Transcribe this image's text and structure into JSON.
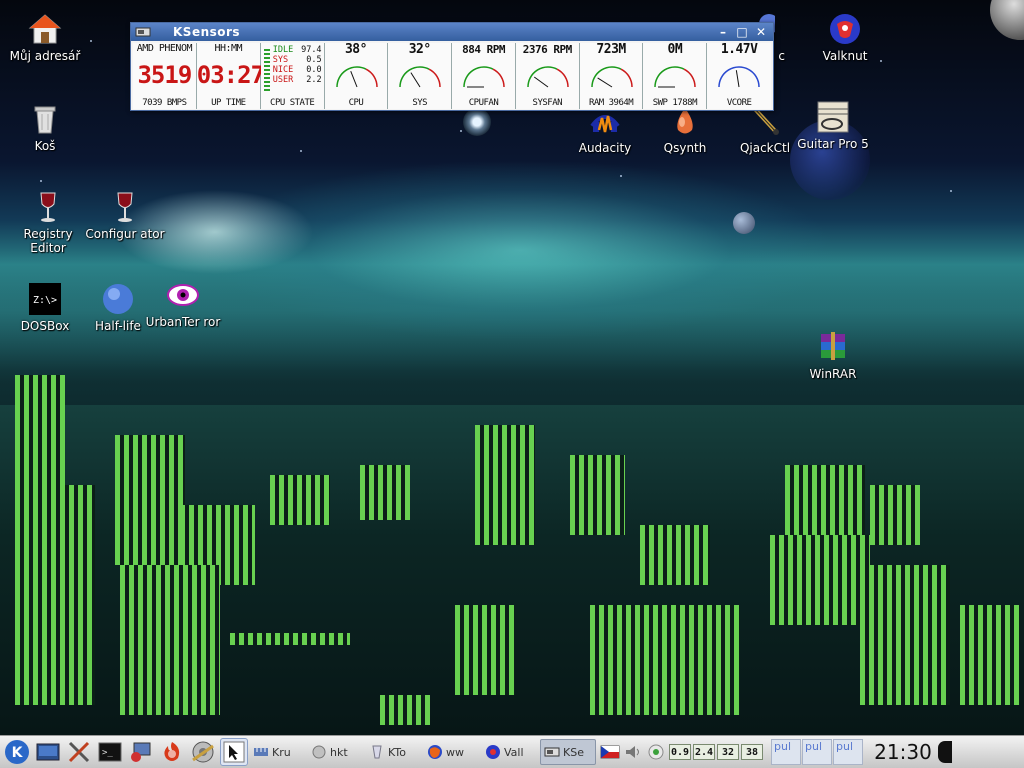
{
  "desktop_icons": [
    {
      "name": "my-home",
      "label": "Můj adresář"
    },
    {
      "name": "trash",
      "label": "Koš"
    },
    {
      "name": "registry-editor",
      "label": "Registry Editor"
    },
    {
      "name": "configurator",
      "label": "Configur ator"
    },
    {
      "name": "dosbox",
      "label": "DOSBox"
    },
    {
      "name": "half-life",
      "label": "Half-life"
    },
    {
      "name": "urban-terror",
      "label": "UrbanTer ror"
    },
    {
      "name": "audacity",
      "label": "Audacity"
    },
    {
      "name": "qsynth",
      "label": "Qsynth"
    },
    {
      "name": "qjackctl",
      "label": "QjackCtl"
    },
    {
      "name": "valknut",
      "label": "Valknut"
    },
    {
      "name": "guitar-pro",
      "label": "Guitar Pro 5"
    },
    {
      "name": "winrar",
      "label": "WinRAR"
    },
    {
      "name": "partial",
      "label": "c"
    }
  ],
  "ksensors": {
    "title": "KSensors",
    "buttons": {
      "minimize": "–",
      "maximize": "□",
      "close": "✕"
    },
    "cpu_clock": {
      "top": "AMD PHENOM",
      "value": "3519",
      "bottom": "7039 BMPS"
    },
    "uptime": {
      "top": "HH:MM",
      "value": "03:27",
      "bottom": "UP TIME"
    },
    "cpu_state": {
      "rows": [
        {
          "k": "IDLE",
          "v": "97.4"
        },
        {
          "k": "SYS",
          "v": "0.5"
        },
        {
          "k": "NICE",
          "v": "0.0"
        },
        {
          "k": "USER",
          "v": "2.2"
        }
      ],
      "bottom": "CPU STATE"
    },
    "gauges": [
      {
        "value": "38°",
        "label": "CPU",
        "level": 0.38
      },
      {
        "value": "32°",
        "label": "SYS",
        "level": 0.32
      },
      {
        "value": "884 RPM",
        "label": "CPUFAN",
        "level": 0.0
      },
      {
        "value": "2376 RPM",
        "label": "SYSFAN",
        "level": 0.2
      },
      {
        "value": "723M",
        "label": "RAM 3964M",
        "level": 0.18
      },
      {
        "value": "0M",
        "label": "SWP 1788M",
        "level": 0.0
      },
      {
        "value": "1.47V",
        "label": "VCORE",
        "level": 0.45
      }
    ]
  },
  "taskbar": {
    "launchers": [
      "kde-menu-icon",
      "desktop-icon",
      "tools-icon",
      "terminal-icon",
      "network-icon",
      "firefox-launch-icon",
      "media-icon",
      "pointer-icon"
    ],
    "tasks": [
      {
        "name": "kruler",
        "label": "Kru",
        "active": false
      },
      {
        "name": "hk",
        "label": "hkt",
        "active": false
      },
      {
        "name": "kto",
        "label": "KTo",
        "active": false
      },
      {
        "name": "firefox",
        "label": "ww",
        "active": false
      },
      {
        "name": "valknut",
        "label": "Vall",
        "active": false
      },
      {
        "name": "ksensors",
        "label": "KSe",
        "active": true
      }
    ],
    "cpu_mini": [
      "0.9",
      "2.4",
      "32",
      "38"
    ],
    "pager": [
      "pul",
      "pul",
      "pul"
    ],
    "clock": "21:30"
  },
  "colors": {
    "accent": "#3a62a8",
    "led_red": "#c91616",
    "gauge_green": "#1a9a1a",
    "gauge_red": "#cc1b1b",
    "gauge_blue": "#2a4ad0"
  }
}
